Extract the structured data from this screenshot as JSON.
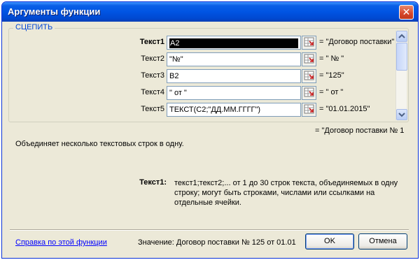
{
  "window": {
    "title": "Аргументы функции",
    "close_glyph": "✕"
  },
  "function": {
    "name": "СЦЕПИТЬ"
  },
  "args": [
    {
      "label": "Текст1",
      "value": "A2",
      "result": "= \"Договор поставки\"",
      "bold": true,
      "selected": true
    },
    {
      "label": "Текст2",
      "value": " \"№\" ",
      "result": "= \" № \"",
      "bold": false,
      "selected": false
    },
    {
      "label": "Текст3",
      "value": "B2",
      "result": "= \"125\"",
      "bold": false,
      "selected": false
    },
    {
      "label": "Текст4",
      "value": "\" от \"",
      "result": "= \" от \"",
      "bold": false,
      "selected": false
    },
    {
      "label": "Текст5",
      "value": "ТЕКСТ(C2;\"ДД.ММ.ГГГГ\")",
      "result": "= \"01.01.2015\"",
      "bold": false,
      "selected": false
    }
  ],
  "formula_result": "= \"Договор поставки № 1",
  "description": "Объединяет несколько текстовых строк в одну.",
  "help": {
    "label": "Текст1:",
    "text": "текст1;текст2;... от 1 до 30 строк текста, объединяемых в одну строку; могут быть строками, числами или ссылками на отдельные ячейки."
  },
  "footer": {
    "help_link": "Справка по этой функции",
    "value_text": "Значение:  Договор поставки № 125 от 01.01",
    "ok_label": "OK",
    "cancel_label": "Отмена"
  },
  "colors": {
    "titlebar": "#0054e3",
    "group_label": "#0046d5",
    "link": "#0000ff",
    "cell_ref_icon_red": "#cc2222"
  }
}
